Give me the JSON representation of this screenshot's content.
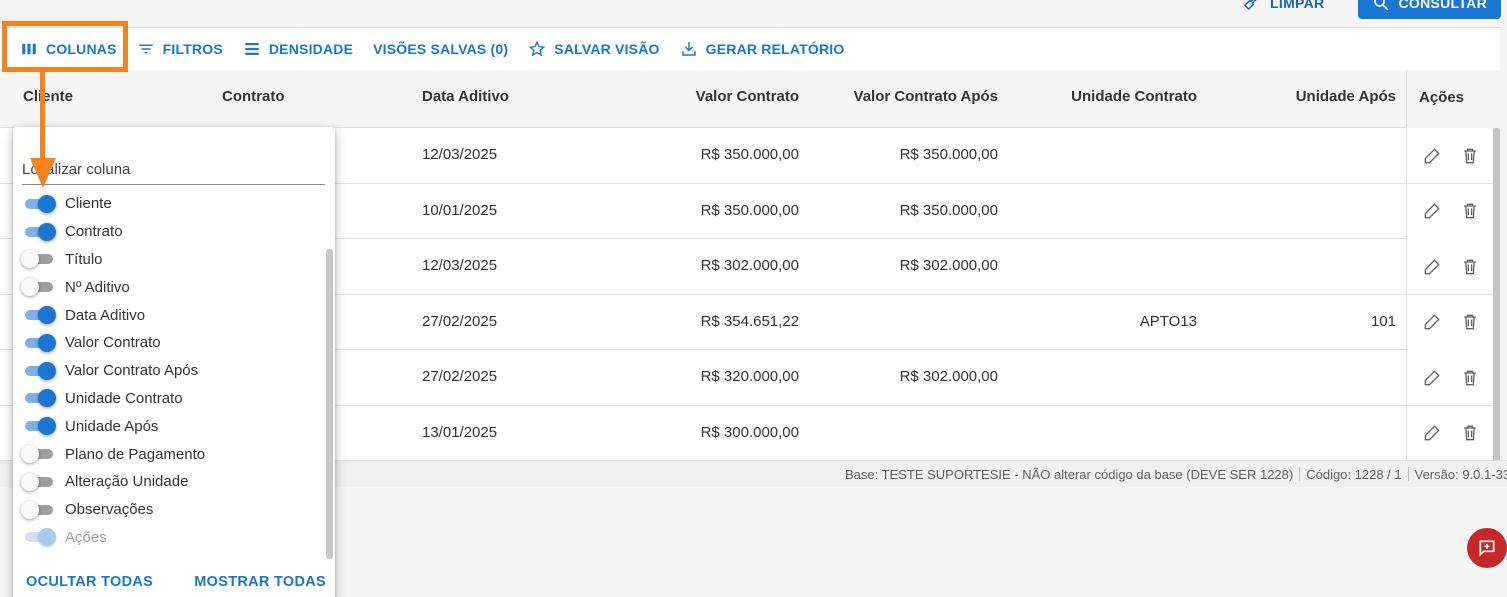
{
  "top": {
    "limpar_label": "LIMPAR",
    "consultar_label": "CONSULTAR"
  },
  "toolbar": {
    "colunas": "COLUNAS",
    "filtros": "FILTROS",
    "densidade": "DENSIDADE",
    "visoes_salvas": "VISÕES SALVAS (0)",
    "salvar_visao": "SALVAR VISÃO",
    "gerar_relatorio": "GERAR RELATÓRIO"
  },
  "headers": {
    "cliente": "Cliente",
    "contrato": "Contrato",
    "data_aditivo": "Data Aditivo",
    "valor_contrato": "Valor Contrato",
    "valor_contrato_apos": "Valor Contrato Após",
    "unidade_contrato": "Unidade Contrato",
    "unidade_apos": "Unidade Após",
    "acoes": "Ações"
  },
  "rows": [
    {
      "data_aditivo": "12/03/2025",
      "valor_contrato": "R$ 350.000,00",
      "valor_contrato_apos": "R$ 350.000,00",
      "unidade_contrato": "",
      "unidade_apos": ""
    },
    {
      "data_aditivo": "10/01/2025",
      "valor_contrato": "R$ 350.000,00",
      "valor_contrato_apos": "R$ 350.000,00",
      "unidade_contrato": "",
      "unidade_apos": ""
    },
    {
      "data_aditivo": "12/03/2025",
      "valor_contrato": "R$ 302.000,00",
      "valor_contrato_apos": "R$ 302.000,00",
      "unidade_contrato": "",
      "unidade_apos": ""
    },
    {
      "data_aditivo": "27/02/2025",
      "valor_contrato": "R$ 354.651,22",
      "valor_contrato_apos": "",
      "unidade_contrato": "APTO13",
      "unidade_apos": "101"
    },
    {
      "data_aditivo": "27/02/2025",
      "valor_contrato": "R$ 320.000,00",
      "valor_contrato_apos": "R$ 302.000,00",
      "unidade_contrato": "",
      "unidade_apos": ""
    },
    {
      "data_aditivo": "13/01/2025",
      "valor_contrato": "R$ 300.000,00",
      "valor_contrato_apos": "",
      "unidade_contrato": "",
      "unidade_apos": ""
    }
  ],
  "footer": {
    "base": "Base: TESTE SUPORTESIE - NÃO alterar código da base (DEVE SER 1228)",
    "codigo": "Código: 1228 / 1",
    "versao": "Versão: 9.0.1-33"
  },
  "columns_panel": {
    "search_placeholder": "Localizar coluna",
    "columns": [
      {
        "label": "Cliente",
        "on": true
      },
      {
        "label": "Contrato",
        "on": true
      },
      {
        "label": "Título",
        "on": false
      },
      {
        "label": "Nº Aditivo",
        "on": false
      },
      {
        "label": "Data Aditivo",
        "on": true
      },
      {
        "label": "Valor Contrato",
        "on": true
      },
      {
        "label": "Valor Contrato Após",
        "on": true
      },
      {
        "label": "Unidade Contrato",
        "on": true
      },
      {
        "label": "Unidade Após",
        "on": true
      },
      {
        "label": "Plano de Pagamento",
        "on": false
      },
      {
        "label": "Alteração Unidade",
        "on": false
      },
      {
        "label": "Observações",
        "on": false
      },
      {
        "label": "Ações",
        "on": true,
        "disabled": true
      }
    ],
    "ocultar_todas": "OCULTAR TODAS",
    "mostrar_todas": "MOSTRAR TODAS"
  },
  "colors": {
    "primary": "#1976d2",
    "highlight": "#f5821f",
    "fab": "#c62828"
  }
}
